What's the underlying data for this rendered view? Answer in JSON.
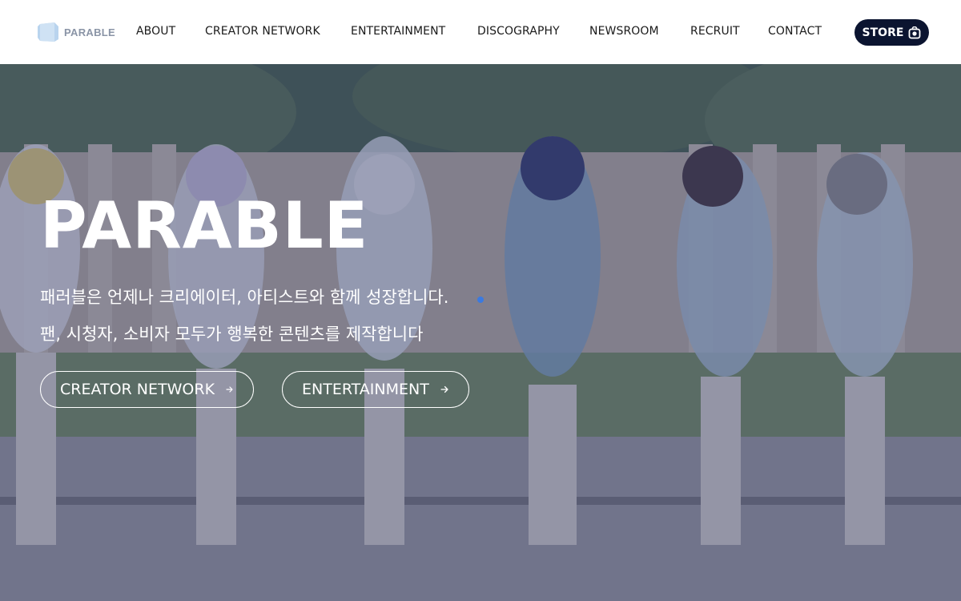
{
  "brand": {
    "name": "PARABLE"
  },
  "nav": {
    "items": [
      {
        "label": "ABOUT"
      },
      {
        "label": "CREATOR NETWORK"
      },
      {
        "label": "ENTERTAINMENT"
      },
      {
        "label": "DISCOGRAPHY"
      },
      {
        "label": "NEWSROOM"
      },
      {
        "label": "RECRUIT"
      },
      {
        "label": "CONTACT"
      }
    ],
    "store_label": "STORE",
    "store_icon": "store-bag-icon"
  },
  "hero": {
    "title": "PARABLE",
    "subtitle_line1": "패러블은 언제나 크리에이터, 아티스트와 함께 성장합니다.",
    "subtitle_line2": "팬, 시청자, 소비자 모두가 행복한 콘텐츠를 제작합니다",
    "buttons": [
      {
        "label": "CREATOR NETWORK",
        "icon": "arrow-right-icon"
      },
      {
        "label": "ENTERTAINMENT",
        "icon": "arrow-right-icon"
      }
    ]
  },
  "colors": {
    "header_bg": "#ffffff",
    "store_bg": "#0b1430",
    "hero_text": "#ffffff",
    "overlay": "#40466e"
  }
}
